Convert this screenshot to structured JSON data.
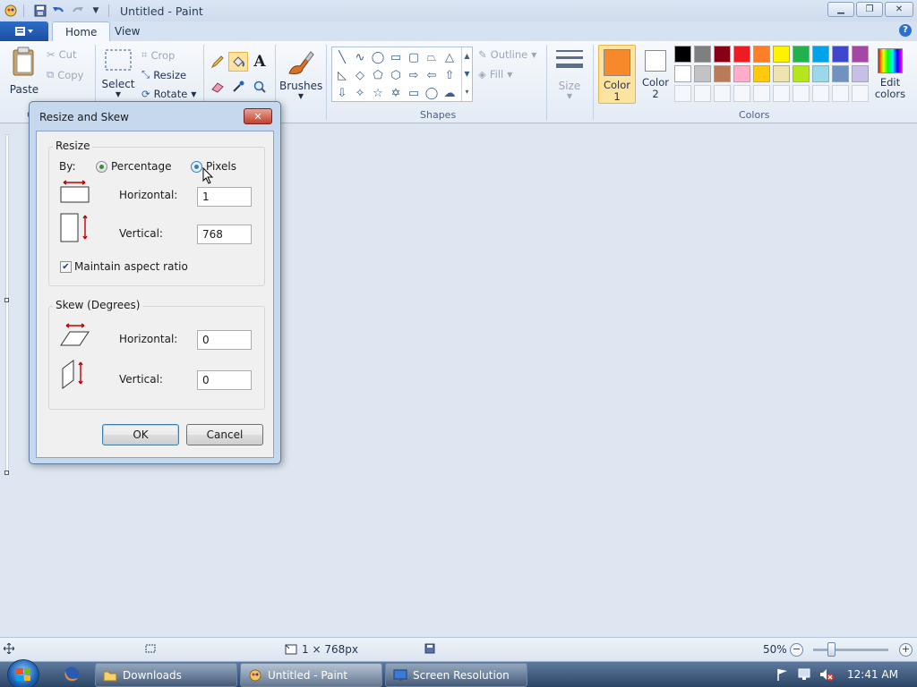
{
  "window": {
    "title": "Untitled - Paint",
    "buttons": {
      "minimize": "▁",
      "restore": "❐",
      "close": "✕"
    }
  },
  "quick_access": {
    "icons": [
      "paint-app-icon",
      "save-icon",
      "undo-icon",
      "redo-icon",
      "customize-dropdown-icon"
    ]
  },
  "tabs": [
    {
      "label": "Home",
      "active": true
    },
    {
      "label": "View",
      "active": false
    }
  ],
  "ribbon": {
    "clipboard": {
      "paste": "Paste",
      "cut": "Cut",
      "copy": "Copy",
      "group_label": "C"
    },
    "image": {
      "select": "Select",
      "crop": "Crop",
      "resize": "Resize",
      "rotate": "Rotate"
    },
    "brushes": "Brushes",
    "shapes": {
      "outline": "Outline",
      "fill": "Fill",
      "group_label": "Shapes"
    },
    "size": "Size",
    "color1": {
      "line1": "Color",
      "line2": "1",
      "value": "#f7892b"
    },
    "color2": {
      "line1": "Color",
      "line2": "2",
      "value": "#ffffff"
    },
    "edit_colors": {
      "line1": "Edit",
      "line2": "colors"
    },
    "colors_group_label": "Colors",
    "palette_row1": [
      "#000000",
      "#7f7f7f",
      "#880015",
      "#ed1c24",
      "#ff7f27",
      "#fff200",
      "#22b14c",
      "#00a2e8",
      "#3f48cc",
      "#a349a4"
    ],
    "palette_row2": [
      "#ffffff",
      "#c3c3c3",
      "#b97a57",
      "#ffaec9",
      "#ffc90e",
      "#efe4b0",
      "#b5e61d",
      "#99d9ea",
      "#7092be",
      "#c8bfe7"
    ]
  },
  "dialog": {
    "title": "Resize and Skew",
    "close_label": "✕",
    "resize": {
      "legend": "Resize",
      "by_label": "By:",
      "option_percentage": "Percentage",
      "option_pixels": "Pixels",
      "horizontal_label": "Horizontal:",
      "horizontal_value": "1",
      "vertical_label": "Vertical:",
      "vertical_value": "768",
      "maintain_aspect": "Maintain aspect ratio",
      "maintain_checked": true
    },
    "skew": {
      "legend": "Skew (Degrees)",
      "horizontal_label": "Horizontal:",
      "horizontal_value": "0",
      "vertical_label": "Vertical:",
      "vertical_value": "0"
    },
    "ok": "OK",
    "cancel": "Cancel"
  },
  "statusbar": {
    "dimensions": "1 × 768px",
    "zoom": "50%"
  },
  "taskbar": {
    "items": [
      {
        "label": "Downloads",
        "icon": "folder-icon"
      },
      {
        "label": "Untitled - Paint",
        "icon": "paint-icon"
      },
      {
        "label": "Screen Resolution",
        "icon": "display-icon"
      }
    ],
    "clock": "12:41 AM"
  }
}
